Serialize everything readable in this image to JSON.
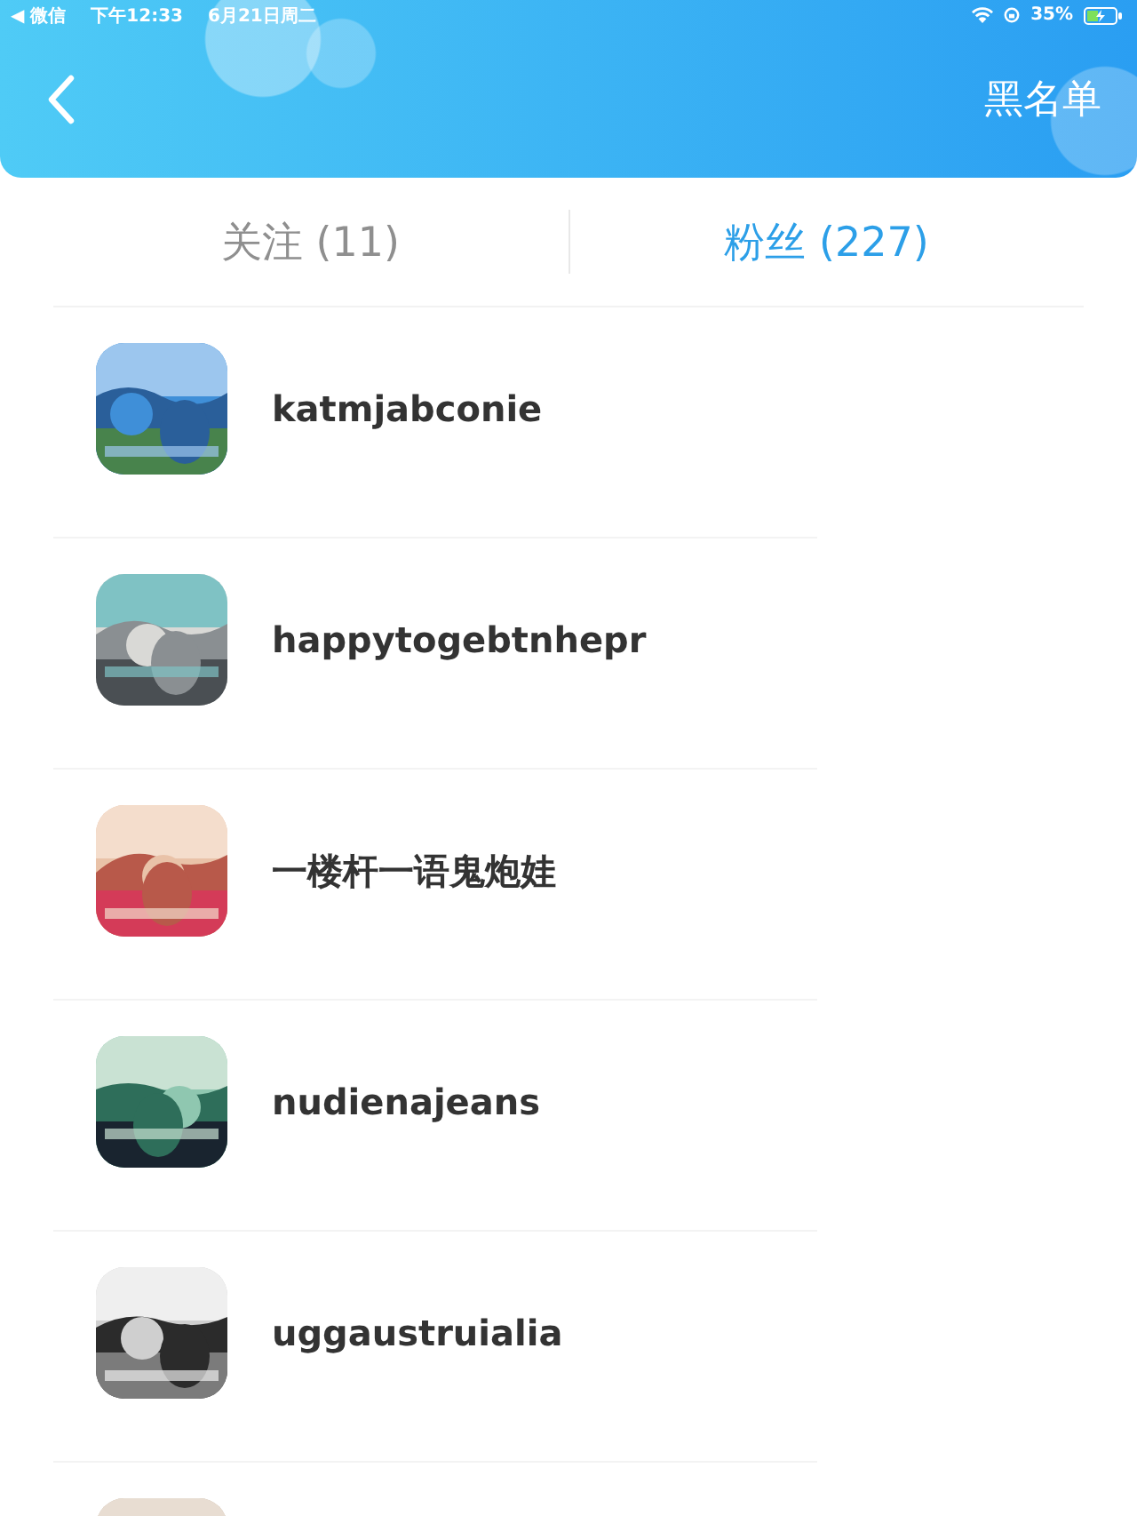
{
  "status_bar": {
    "back_app": "◀ 微信",
    "time": "下午12:33",
    "date": "6月21日周二",
    "battery": "35%"
  },
  "header": {
    "title": "黑名单"
  },
  "tabs": [
    {
      "label": "关注 (11)",
      "selected": false
    },
    {
      "label": "粉丝 (227)",
      "selected": true
    }
  ],
  "users": [
    {
      "name": "katmjabconie",
      "avatar": {
        "kind": "picture"
      }
    },
    {
      "name": "happytogebtnhepr",
      "avatar": {
        "kind": "picture"
      }
    },
    {
      "name": "一楼杆一语鬼炮娃",
      "avatar": {
        "kind": "picture"
      }
    },
    {
      "name": "nudienajeans",
      "avatar": {
        "kind": "picture"
      }
    },
    {
      "name": "uggaustruialia",
      "avatar": {
        "kind": "picture"
      }
    },
    {
      "avatar": {
        "kind": "picture"
      }
    }
  ]
}
